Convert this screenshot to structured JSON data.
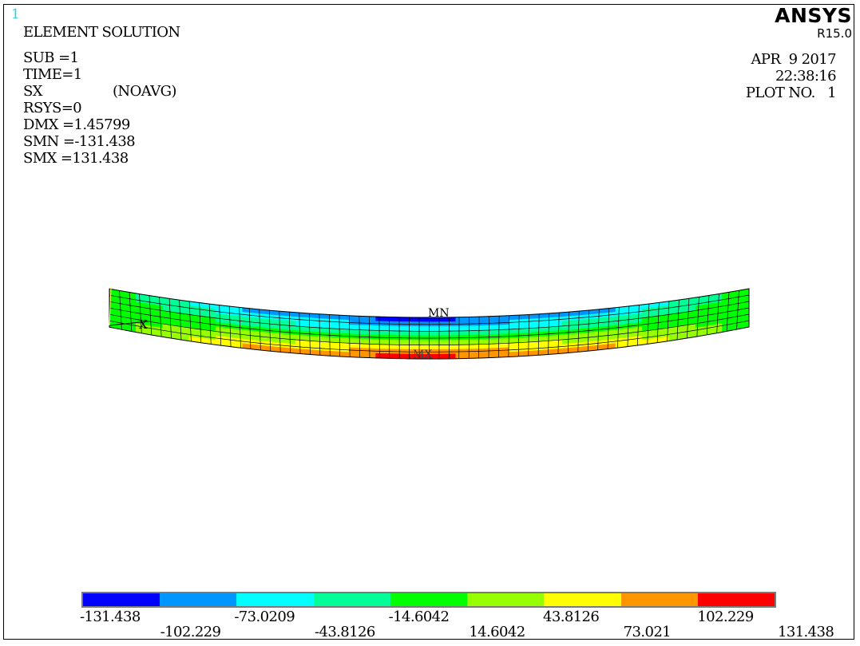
{
  "window_number": "1",
  "brand": {
    "name": "ANSYS",
    "version": "R15.0"
  },
  "title": "ELEMENT SOLUTION",
  "info": {
    "sub": "SUB =1",
    "time": "TIME=1",
    "item": "SX",
    "avg": "(NOAVG)",
    "rsys": "RSYS=0",
    "dmx": "DMX =1.45799",
    "smn": "SMN =-131.438",
    "smx": "SMX =131.438"
  },
  "date": "APR  9 2017",
  "clock": "22:38:16",
  "plot_no": "PLOT NO.   1",
  "markers": {
    "min": "MN",
    "max": "MX"
  },
  "axis_label": "X",
  "legend": {
    "colors": [
      "#0000ff",
      "#0096ff",
      "#00ffff",
      "#00ff96",
      "#00ff00",
      "#96ff00",
      "#ffff00",
      "#ff9600",
      "#ff0000"
    ],
    "values_upper": [
      "-131.438",
      "-73.0209",
      "-14.6042",
      "43.8126",
      "102.229"
    ],
    "values_lower": [
      "-102.229",
      "-43.8126",
      "14.6042",
      "73.021",
      "131.438"
    ]
  },
  "contour": {
    "levels": [
      -131.438,
      -102.229,
      -73.0209,
      -43.8126,
      -14.6042,
      14.6042,
      43.8126,
      73.021,
      102.229,
      131.438
    ]
  }
}
